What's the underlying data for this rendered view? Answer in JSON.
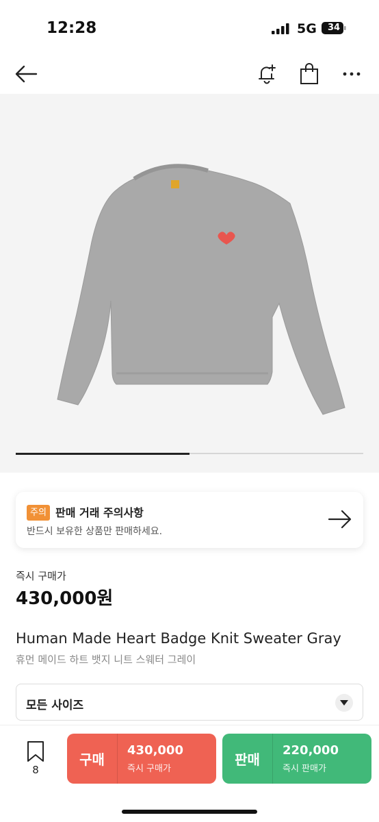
{
  "status_bar": {
    "time": "12:28",
    "network": "5G",
    "battery": "34",
    "icons": [
      "signal-icon",
      "battery-icon"
    ]
  },
  "nav": {
    "icons": [
      "back-arrow-icon",
      "bell-plus-icon",
      "shopping-bag-icon",
      "more-icon"
    ]
  },
  "gallery": {
    "image": "gray-knit-sweater-with-red-heart-badge",
    "progress": 0.5,
    "colors": {
      "sweater": "#a9a9a9",
      "heart_badge": "#e8564f",
      "label": "#e0a52a"
    }
  },
  "notice": {
    "badge": "주의",
    "title": "판매 거래 주의사항",
    "subtitle": "반드시 보유한 상품만 판매하세요.",
    "badge_color": "#f19136",
    "arrow_icon": "arrow-right-icon"
  },
  "price": {
    "label": "즉시 구매가",
    "value": "430,000원"
  },
  "product": {
    "name_en": "Human Made Heart Badge Knit Sweater Gray",
    "name_ko": "휴먼 메이드 하트 뱃지 니트 스웨터 그레이"
  },
  "size_select": {
    "value": "모든 사이즈",
    "icon": "chevron-down-icon"
  },
  "bottom_bar": {
    "bookmark_count": "8",
    "buy": {
      "kind": "구매",
      "price": "430,000",
      "sub": "즉시 구매가",
      "color": "#ef6253"
    },
    "sell": {
      "kind": "판매",
      "price": "220,000",
      "sub": "즉시 판매가",
      "color": "#41b979"
    }
  }
}
